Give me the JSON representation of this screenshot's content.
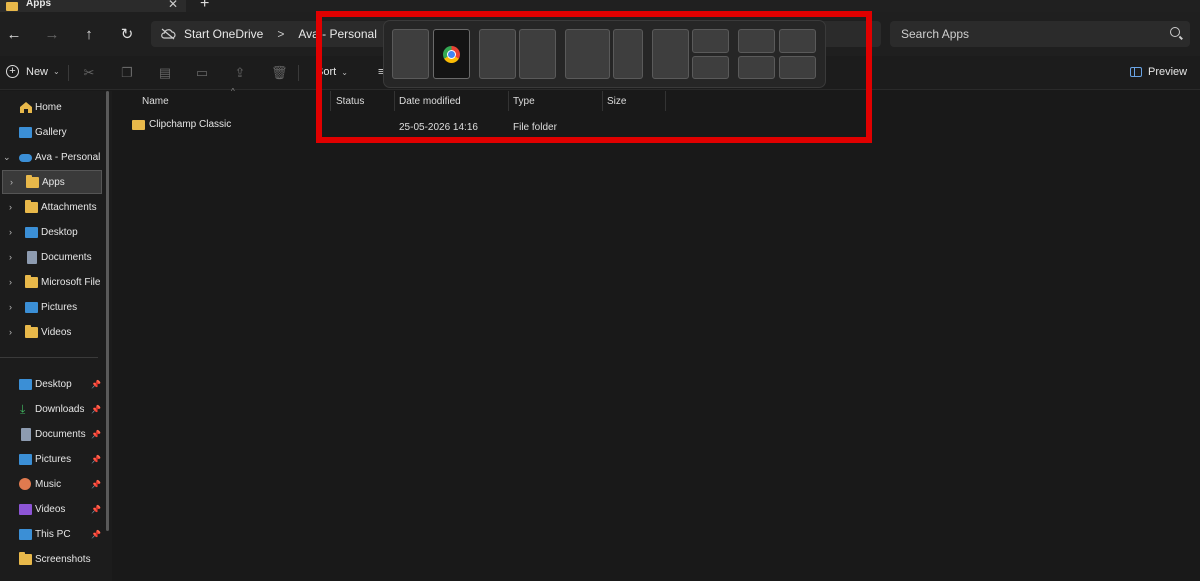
{
  "window": {
    "tab_title": "Apps",
    "close_glyph": "✕",
    "new_tab_glyph": "+"
  },
  "nav": {
    "back_glyph": "←",
    "forward_glyph": "→",
    "up_glyph": "↑",
    "refresh_glyph": "↻",
    "breadcrumb": [
      "Start OneDrive",
      "Ava - Personal"
    ],
    "separator": ">",
    "search_placeholder": "Search Apps"
  },
  "toolbar": {
    "new_label": "New",
    "sort_label": "Sort",
    "view_glyph": "≡",
    "preview_label": "Preview",
    "caret": "⌄"
  },
  "sidebar": {
    "top_items": [
      {
        "label": "Home",
        "icon": "home-icon"
      },
      {
        "label": "Gallery",
        "icon": "gallery-icon"
      },
      {
        "label": "Ava - Personal",
        "icon": "onedrive-icon",
        "expanded": true
      },
      {
        "label": "Apps",
        "icon": "folder-icon",
        "selected": true
      },
      {
        "label": "Attachments",
        "icon": "folder-icon"
      },
      {
        "label": "Desktop",
        "icon": "desktop-icon"
      },
      {
        "label": "Documents",
        "icon": "documents-icon"
      },
      {
        "label": "Microsoft File S",
        "icon": "folder-icon"
      },
      {
        "label": "Pictures",
        "icon": "pictures-icon"
      },
      {
        "label": "Videos",
        "icon": "folder-icon"
      }
    ],
    "pinned_items": [
      {
        "label": "Desktop",
        "icon": "desktop-icon"
      },
      {
        "label": "Downloads",
        "icon": "downloads-icon"
      },
      {
        "label": "Documents",
        "icon": "documents-icon"
      },
      {
        "label": "Pictures",
        "icon": "pictures-icon"
      },
      {
        "label": "Music",
        "icon": "music-icon"
      },
      {
        "label": "Videos",
        "icon": "videos-icon"
      },
      {
        "label": "This PC",
        "icon": "this-pc-icon"
      },
      {
        "label": "Screenshots",
        "icon": "folder-icon"
      }
    ]
  },
  "columns": {
    "name": "Name",
    "status": "Status",
    "date": "Date modified",
    "type": "Type",
    "size": "Size"
  },
  "rows": [
    {
      "name": "Clipchamp Classic",
      "date": "25-05-2026 14:16",
      "type": "File folder",
      "size": ""
    }
  ],
  "snap_layouts": {
    "active_app_icon": "chrome-icon"
  },
  "colors": {
    "highlight": "#e00000",
    "background": "#191919",
    "folder": "#e8b84a",
    "accent": "#3b8fd6"
  }
}
